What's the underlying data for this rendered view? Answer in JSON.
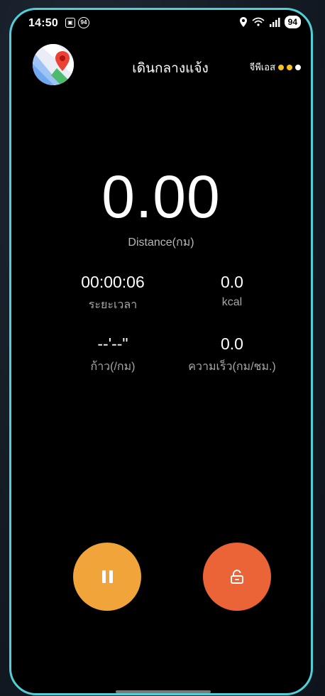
{
  "status_bar": {
    "time": "14:50",
    "notification_badge": "94",
    "battery": "94",
    "icons": [
      "screenshot-icon",
      "badge-94-icon",
      "location-icon",
      "wifi-icon",
      "signal-icon",
      "battery-icon"
    ]
  },
  "header": {
    "title": "เดินกลางแจ้ง",
    "gps_label": "จีพีเอส",
    "gps_dots": [
      "#f6c21c",
      "#f6c21c",
      "#ffffff"
    ],
    "logo_icon": "maps-pin-icon"
  },
  "metrics": {
    "distance_value": "0.00",
    "distance_label": "Distance(กม)",
    "duration_value": "00:00:06",
    "duration_label": "ระยะเวลา",
    "calories_value": "0.0",
    "calories_label": "kcal",
    "pace_value": "--'--\"",
    "pace_label": "ก้าว(/กม)",
    "speed_value": "0.0",
    "speed_label": "ความเร็ว(กม/ชม.)"
  },
  "controls": {
    "pause_icon": "pause-icon",
    "lock_icon": "unlock-icon",
    "pause_color": "#f0a43a",
    "lock_color": "#eb6437"
  }
}
